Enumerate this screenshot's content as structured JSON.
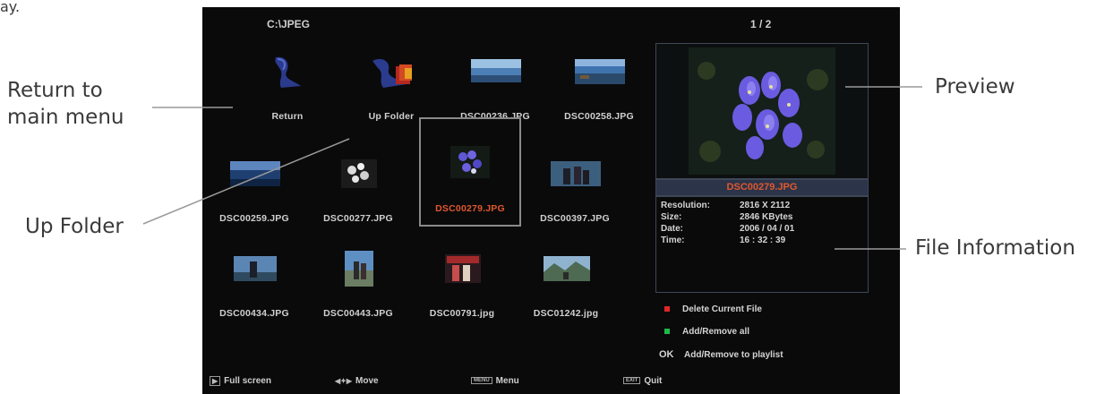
{
  "annotations": {
    "top_fragment": "ay.",
    "return_line1": "Return to",
    "return_line2": "main menu",
    "up_folder": "Up Folder",
    "preview": "Preview",
    "file_information": "File Information"
  },
  "header": {
    "path": "C:\\JPEG",
    "page_indicator": "1 / 2"
  },
  "grid": {
    "items": [
      {
        "label": "Return",
        "kind": "return-icon"
      },
      {
        "label": "Up Folder",
        "kind": "up-folder-icon"
      },
      {
        "label": "DSC00236.JPG",
        "kind": "photo"
      },
      {
        "label": "DSC00258.JPG",
        "kind": "photo"
      },
      {
        "label": "DSC00259.JPG",
        "kind": "photo"
      },
      {
        "label": "DSC00277.JPG",
        "kind": "photo"
      },
      {
        "label": "DSC00279.JPG",
        "kind": "photo",
        "selected": true
      },
      {
        "label": "DSC00397.JPG",
        "kind": "photo"
      },
      {
        "label": "DSC00434.JPG",
        "kind": "photo"
      },
      {
        "label": "DSC00443.JPG",
        "kind": "photo"
      },
      {
        "label": "DSC00791.jpg",
        "kind": "photo"
      },
      {
        "label": "DSC01242.jpg",
        "kind": "photo"
      }
    ]
  },
  "preview": {
    "filename": "DSC00279.JPG"
  },
  "file_info": {
    "resolution_label": "Resolution:",
    "resolution": "2816 X 2112",
    "size_label": "Size:",
    "size": "2846 KBytes",
    "date_label": "Date:",
    "date": "2006 / 04 / 01",
    "time_label": "Time:",
    "time": "16 : 32 : 39"
  },
  "legend": {
    "delete": "Delete Current File",
    "add_remove_all": "Add/Remove all",
    "ok_key": "OK",
    "add_remove_playlist": "Add/Remove to playlist",
    "colors": {
      "red": "#e0262b",
      "green": "#1fb84a",
      "accent": "#e0572e"
    }
  },
  "footer": {
    "full_screen": "Full screen",
    "move": "Move",
    "menu": "Menu",
    "menu_key": "MENU",
    "quit": "Quit",
    "quit_key": "EXIT"
  }
}
